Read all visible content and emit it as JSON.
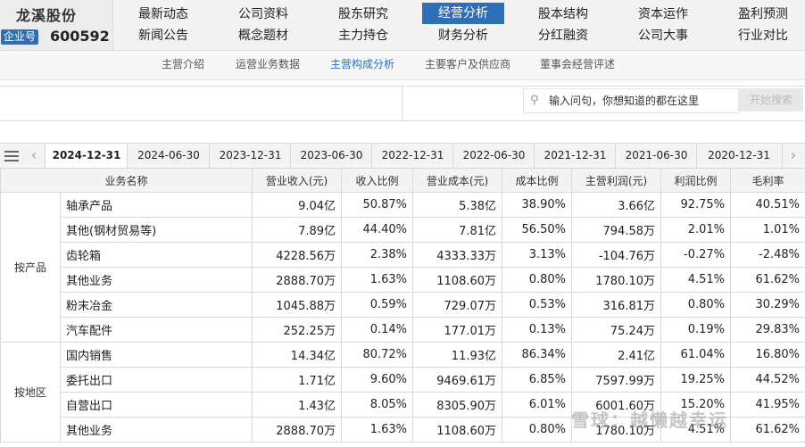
{
  "company": {
    "name": "龙溪股份",
    "tag": "企业号",
    "code": "600592"
  },
  "nav_row1": [
    "最新动态",
    "公司资料",
    "股东研究",
    "经营分析",
    "股本结构",
    "资本运作",
    "盈利预测"
  ],
  "nav_row2": [
    "新闻公告",
    "概念题材",
    "主力持仓",
    "财务分析",
    "分红融资",
    "公司大事",
    "行业对比"
  ],
  "sub_nav": [
    "主营介绍",
    "运营业务数据",
    "主营构成分析",
    "主要客户及供应商",
    "董事会经营评述"
  ],
  "search": {
    "placeholder": "输入问句，你想知道的都在这里",
    "button": "开始搜索"
  },
  "date_tabs": [
    "2024-12-31",
    "2024-06-30",
    "2023-12-31",
    "2023-06-30",
    "2022-12-31",
    "2022-06-30",
    "2021-12-31",
    "2021-06-30",
    "2020-12-31"
  ],
  "table": {
    "headers": [
      "业务名称",
      "营业收入(元)",
      "收入比例",
      "营业成本(元)",
      "成本比例",
      "主营利润(元)",
      "利润比例",
      "毛利率"
    ],
    "groups": [
      {
        "label": "按产品",
        "rows": [
          [
            "轴承产品",
            "9.04亿",
            "50.87%",
            "5.38亿",
            "38.90%",
            "3.66亿",
            "92.75%",
            "40.51%"
          ],
          [
            "其他(钢材贸易等)",
            "7.89亿",
            "44.40%",
            "7.81亿",
            "56.50%",
            "794.58万",
            "2.01%",
            "1.01%"
          ],
          [
            "齿轮箱",
            "4228.56万",
            "2.38%",
            "4333.33万",
            "3.13%",
            "-104.76万",
            "-0.27%",
            "-2.48%"
          ],
          [
            "其他业务",
            "2888.70万",
            "1.63%",
            "1108.60万",
            "0.80%",
            "1780.10万",
            "4.51%",
            "61.62%"
          ],
          [
            "粉末冶金",
            "1045.88万",
            "0.59%",
            "729.07万",
            "0.53%",
            "316.81万",
            "0.80%",
            "30.29%"
          ],
          [
            "汽车配件",
            "252.25万",
            "0.14%",
            "177.01万",
            "0.13%",
            "75.24万",
            "0.19%",
            "29.83%"
          ]
        ]
      },
      {
        "label": "按地区",
        "rows": [
          [
            "国内销售",
            "14.34亿",
            "80.72%",
            "11.93亿",
            "86.34%",
            "2.41亿",
            "61.04%",
            "16.80%"
          ],
          [
            "委托出口",
            "1.71亿",
            "9.60%",
            "9469.61万",
            "6.85%",
            "7597.99万",
            "19.25%",
            "44.52%"
          ],
          [
            "自营出口",
            "1.43亿",
            "8.05%",
            "8305.90万",
            "6.01%",
            "6001.60万",
            "15.20%",
            "41.95%"
          ],
          [
            "其他业务",
            "2888.70万",
            "1.63%",
            "1108.60万",
            "0.80%",
            "1780.10万",
            "4.51%",
            "61.62%"
          ]
        ]
      }
    ]
  },
  "watermark": "雪球：越懒越幸运"
}
